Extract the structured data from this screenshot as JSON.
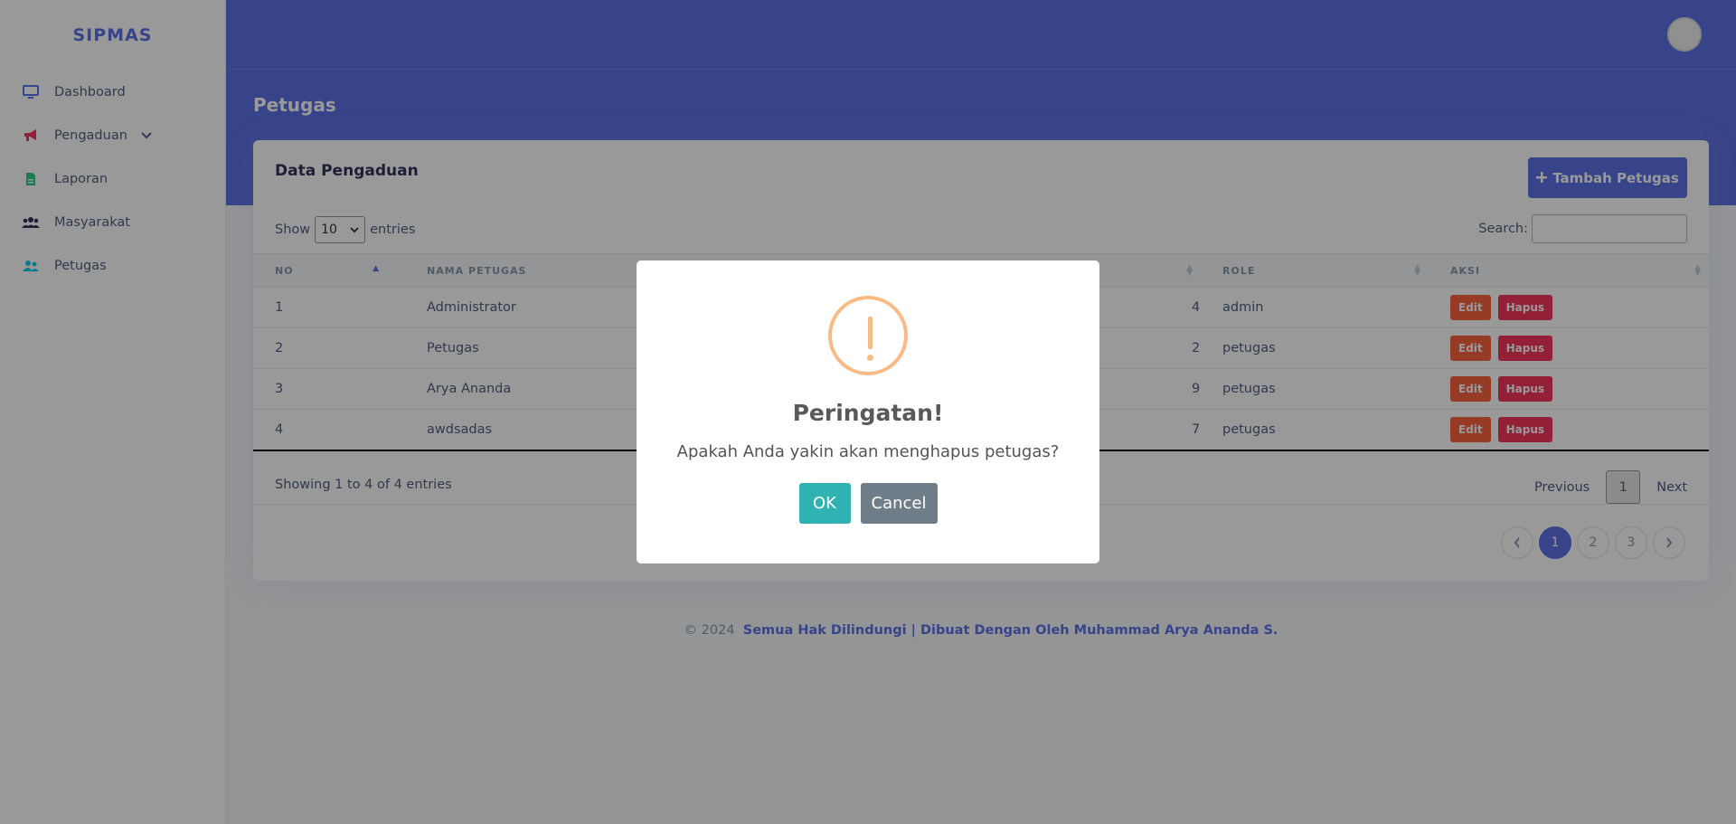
{
  "brand": "SIPMAS",
  "sidebar": {
    "items": [
      {
        "label": "Dashboard",
        "icon": "desktop-icon",
        "color": "#5e72e4"
      },
      {
        "label": "Pengaduan",
        "icon": "megaphone-icon",
        "color": "#f5365c"
      },
      {
        "label": "Laporan",
        "icon": "document-icon",
        "color": "#2dce89"
      },
      {
        "label": "Masyarakat",
        "icon": "users-icon",
        "color": "#32325d"
      },
      {
        "label": "Petugas",
        "icon": "user-group-icon",
        "color": "#11cdef"
      }
    ]
  },
  "header": {
    "page_title": "Petugas"
  },
  "card": {
    "title": "Data Pengaduan",
    "add_button": "Tambah Petugas",
    "show_label": "Show",
    "entries_label": "entries",
    "entries_value": "10",
    "search_label": "Search:",
    "columns": [
      "NO",
      "NAMA PETUGAS",
      "",
      "ROLE",
      "AKSI"
    ],
    "rows": [
      {
        "no": "1",
        "nama": "Administrator",
        "partial": "4",
        "role": "admin"
      },
      {
        "no": "2",
        "nama": "Petugas",
        "partial": "2",
        "role": "petugas"
      },
      {
        "no": "3",
        "nama": "Arya Ananda",
        "partial": "9",
        "role": "petugas"
      },
      {
        "no": "4",
        "nama": "awdsadas",
        "partial": "7",
        "role": "petugas"
      }
    ],
    "edit_label": "Edit",
    "delete_label": "Hapus",
    "showing_text": "Showing 1 to 4 of 4 entries",
    "pager": {
      "previous": "Previous",
      "current": "1",
      "next": "Next"
    },
    "pagination": [
      "1",
      "2",
      "3"
    ]
  },
  "footer": {
    "copyright": "© 2024",
    "credit": "Semua Hak Dilindungi | Dibuat Dengan Oleh Muhammad Arya Ananda S."
  },
  "modal": {
    "icon": "warning-icon",
    "title": "Peringatan!",
    "message": "Apakah Anda yakin akan menghapus petugas?",
    "ok_label": "OK",
    "cancel_label": "Cancel"
  },
  "colors": {
    "primary": "#5e72e4",
    "warning": "#fb6340",
    "danger": "#f5365c",
    "ok": "#30b2b2",
    "cancel": "#6e7d88"
  }
}
